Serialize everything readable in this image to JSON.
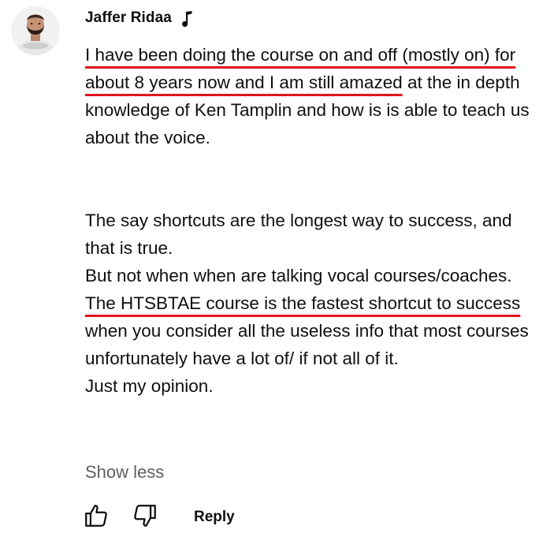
{
  "comment": {
    "author": "Jaffer Ridaa",
    "author_badge_icon": "music-note-icon",
    "paragraphs": [
      {
        "segments": [
          {
            "text": "I have been doing the course on and off (mostly on) for about 8 years now and I am still amazed",
            "underlined": true
          },
          {
            "text": " at the in depth knowledge of Ken Tamplin and how is is able to teach us about the voice.",
            "underlined": false
          }
        ]
      },
      {
        "segments": [
          {
            "text": "The say shortcuts are the longest way to success, and that is true.",
            "underlined": false
          }
        ]
      },
      {
        "segments": [
          {
            "text": "But not when when are talking vocal courses/coaches.",
            "underlined": false
          }
        ]
      },
      {
        "segments": [
          {
            "text": "The HTSBTAE course is the fastest shortcut to success",
            "underlined": true
          },
          {
            "text": " when you consider all the useless info that most courses unfortunately have a lot of/ if not all of it.",
            "underlined": false
          }
        ]
      },
      {
        "segments": [
          {
            "text": "Just my opinion.",
            "underlined": false
          }
        ]
      }
    ],
    "show_less_label": "Show less",
    "reply_label": "Reply",
    "annotation_color": "#e0141e"
  },
  "icons": {
    "like": "thumbs-up-icon",
    "dislike": "thumbs-down-icon",
    "avatar": "avatar"
  }
}
